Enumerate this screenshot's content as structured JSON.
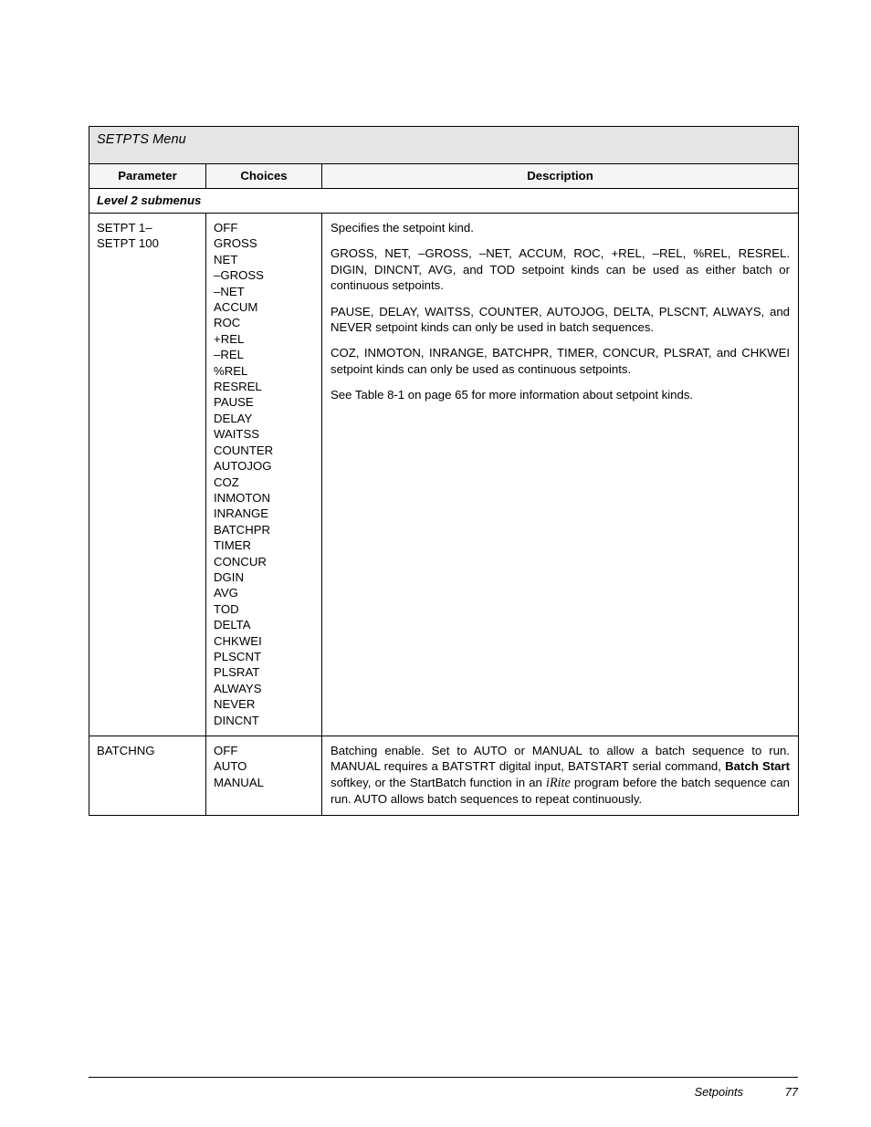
{
  "table": {
    "title": "SETPTS Menu",
    "columns": {
      "parameter": "Parameter",
      "choices": "Choices",
      "description": "Description"
    },
    "section_heading": "Level 2 submenus",
    "rows": [
      {
        "parameter": "SETPT 1–\nSETPT 100",
        "choices": "OFF\nGROSS\nNET\n–GROSS\n–NET\nACCUM\nROC\n+REL\n–REL\n%REL\nRESREL\nPAUSE\nDELAY\nWAITSS\nCOUNTER\nAUTOJOG\nCOZ\nINMOTON\nINRANGE\nBATCHPR\nTIMER\nCONCUR\nDGIN\nAVG\nTOD\nDELTA\nCHKWEI\nPLSCNT\nPLSRAT\nALWAYS\nNEVER\nDINCNT",
        "description_paragraphs": [
          "Specifies the setpoint kind.",
          "GROSS, NET, –GROSS, –NET, ACCUM, ROC, +REL, –REL, %REL, RESREL. DIGIN, DINCNT, AVG, and TOD setpoint kinds can be used as either batch or continuous setpoints.",
          "PAUSE, DELAY, WAITSS, COUNTER, AUTOJOG, DELTA, PLSCNT, ALWAYS, and NEVER setpoint kinds can only be used in batch sequences.",
          "COZ, INMOTON, INRANGE, BATCHPR, TIMER, CONCUR, PLSRAT, and CHKWEI setpoint kinds can only be used as continuous setpoints.",
          "See Table 8-1 on page 65 for more information about setpoint kinds."
        ]
      },
      {
        "parameter": "BATCHNG",
        "choices": "OFF\nAUTO\nMANUAL",
        "description_rich": {
          "part1": "Batching enable. Set to AUTO or MANUAL to allow a batch sequence to run. MANUAL requires a BATSTRT digital input, BATSTART serial command, ",
          "bold1": "Batch Start",
          "part2": " softkey, or the StartBatch function in an ",
          "italic1": "iRite",
          "part3": " program before the batch sequence can run. AUTO allows batch sequences to repeat continuously."
        }
      }
    ]
  },
  "footer": {
    "section": "Setpoints",
    "page_number": "77"
  }
}
